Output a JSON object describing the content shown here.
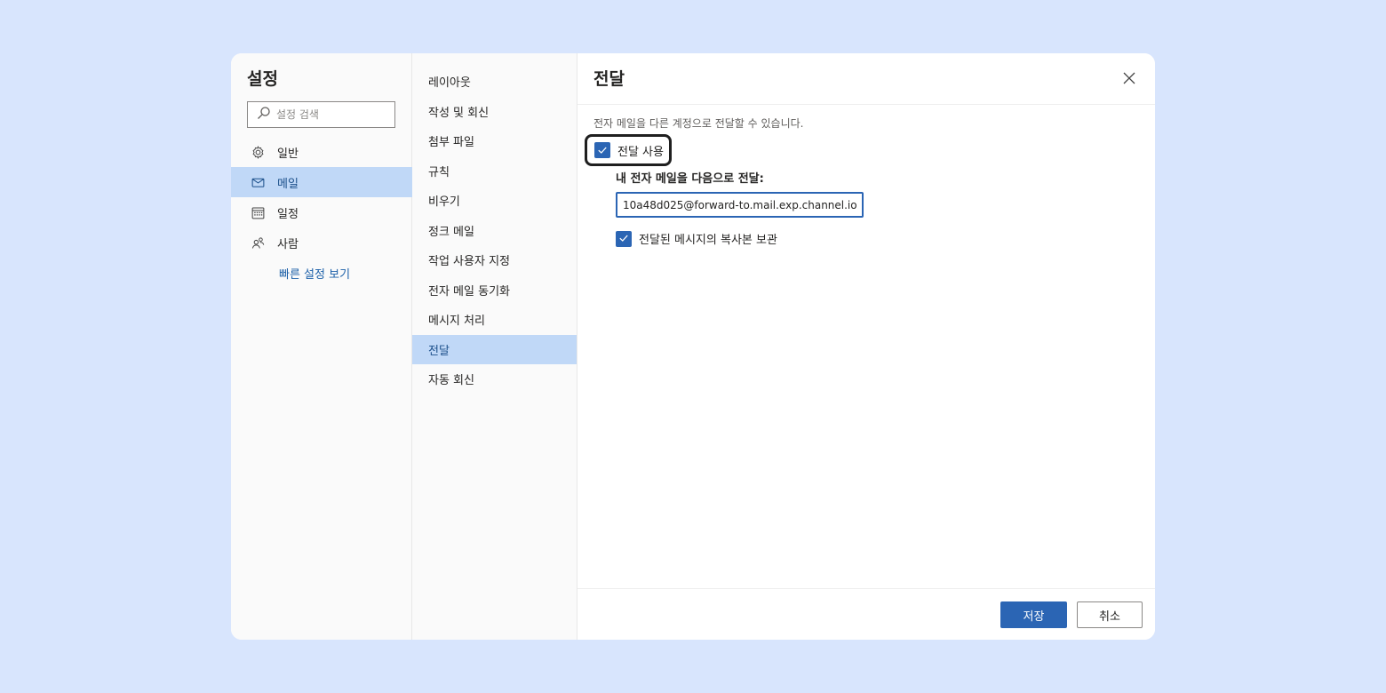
{
  "settings": {
    "title": "설정",
    "search_placeholder": "설정 검색",
    "nav": [
      {
        "label": "일반",
        "icon": "gear-icon"
      },
      {
        "label": "메일",
        "icon": "mail-icon",
        "active": true
      },
      {
        "label": "일정",
        "icon": "calendar-icon"
      },
      {
        "label": "사람",
        "icon": "people-icon"
      }
    ],
    "quick_settings_link": "빠른 설정 보기"
  },
  "mail_sections": [
    "레이아웃",
    "작성 및 회신",
    "첨부 파일",
    "규칙",
    "비우기",
    "정크 메일",
    "작업 사용자 지정",
    "전자 메일 동기화",
    "메시지 처리",
    "전달",
    "자동 회신"
  ],
  "active_section": "전달",
  "forwarding": {
    "title": "전달",
    "description": "전자 메일을 다른 계정으로 전달할 수 있습니다.",
    "enable_label": "전달 사용",
    "enable_checked": true,
    "forward_to_label": "내 전자 메일을 다음으로 전달:",
    "forward_to_value": "10a48d025@forward-to.mail.exp.channel.io",
    "keep_copy_label": "전달된 메시지의 복사본 보관",
    "keep_copy_checked": true
  },
  "footer": {
    "save_label": "저장",
    "cancel_label": "취소"
  },
  "colors": {
    "page_background": "#d8e5fd",
    "accent": "#2b65b4",
    "selected_background": "#c0d8f7"
  }
}
